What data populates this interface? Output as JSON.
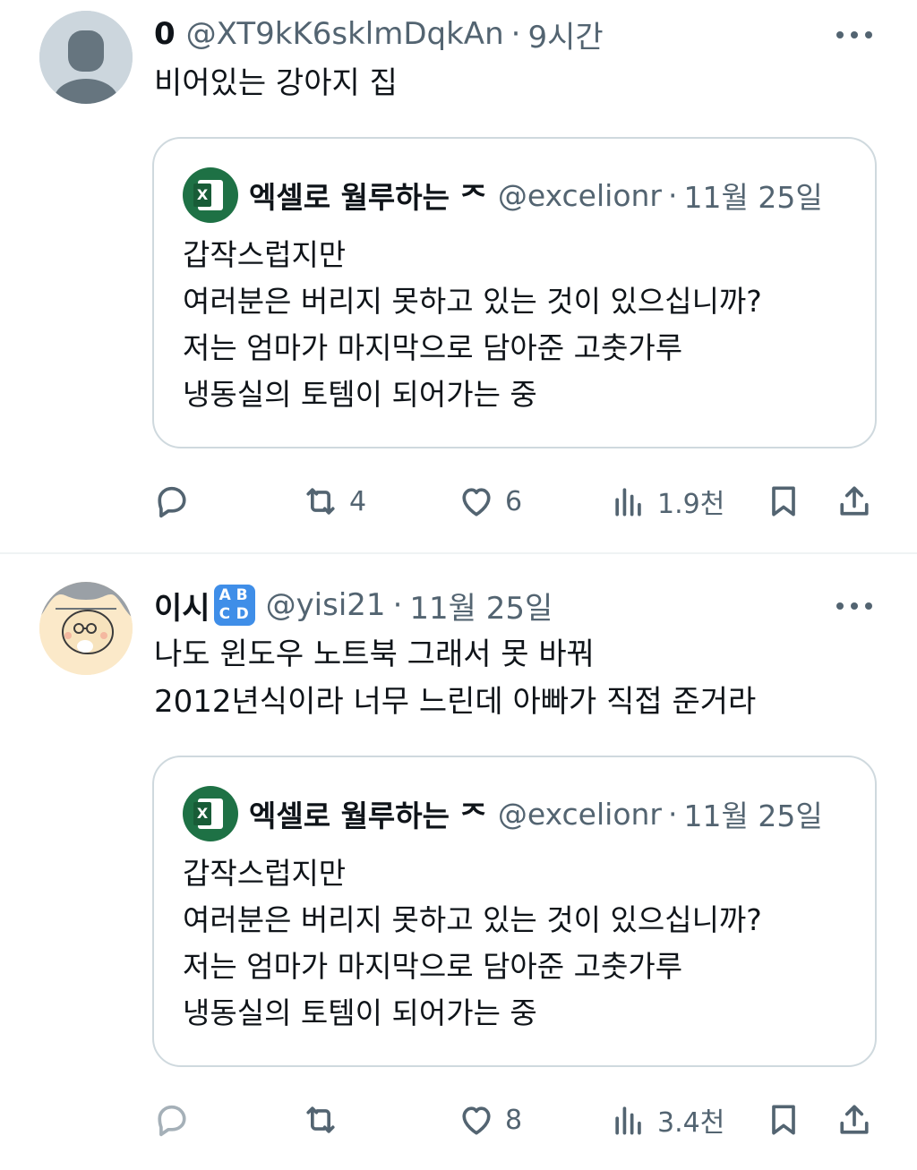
{
  "tweets": [
    {
      "author_name": "0",
      "handle": "@XT9kK6sklmDqkAn",
      "dot": "·",
      "time": "9시간",
      "text": "비어있는 강아지 집",
      "quote": {
        "author_name": "엑셀로 월루하는 ᄌ",
        "handle": "@excelionr",
        "dot": "·",
        "time": "11월 25일",
        "text": "갑작스럽지만\n여러분은 버리지 못하고 있는 것이 있으십니까?\n저는 엄마가 마지막으로 담아준 고춧가루\n냉동실의 토템이 되어가는 중"
      },
      "stats": {
        "replies": "",
        "retweets": "4",
        "likes": "6",
        "views": "1.9천"
      }
    },
    {
      "author_name": "이시",
      "badge_icon": "abcd-emoji-icon",
      "handle": "@yisi21",
      "dot": "·",
      "time": "11월 25일",
      "text": "나도 윈도우 노트북 그래서 못 바꿔\n2012년식이라 너무 느린데 아빠가 직접 준거라",
      "quote": {
        "author_name": "엑셀로 월루하는 ᄌ",
        "handle": "@excelionr",
        "dot": "·",
        "time": "11월 25일",
        "text": "갑작스럽지만\n여러분은 버리지 못하고 있는 것이 있으십니까?\n저는 엄마가 마지막으로 담아준 고춧가루\n냉동실의 토템이 되어가는 중"
      },
      "stats": {
        "replies": "",
        "retweets": "",
        "likes": "8",
        "views": "3.4천"
      }
    }
  ],
  "colors": {
    "text": "#0f1419",
    "secondary": "#536471",
    "border": "#cfd9de",
    "excel_green": "#1e7145",
    "badge_blue": "#3f8ee8"
  }
}
